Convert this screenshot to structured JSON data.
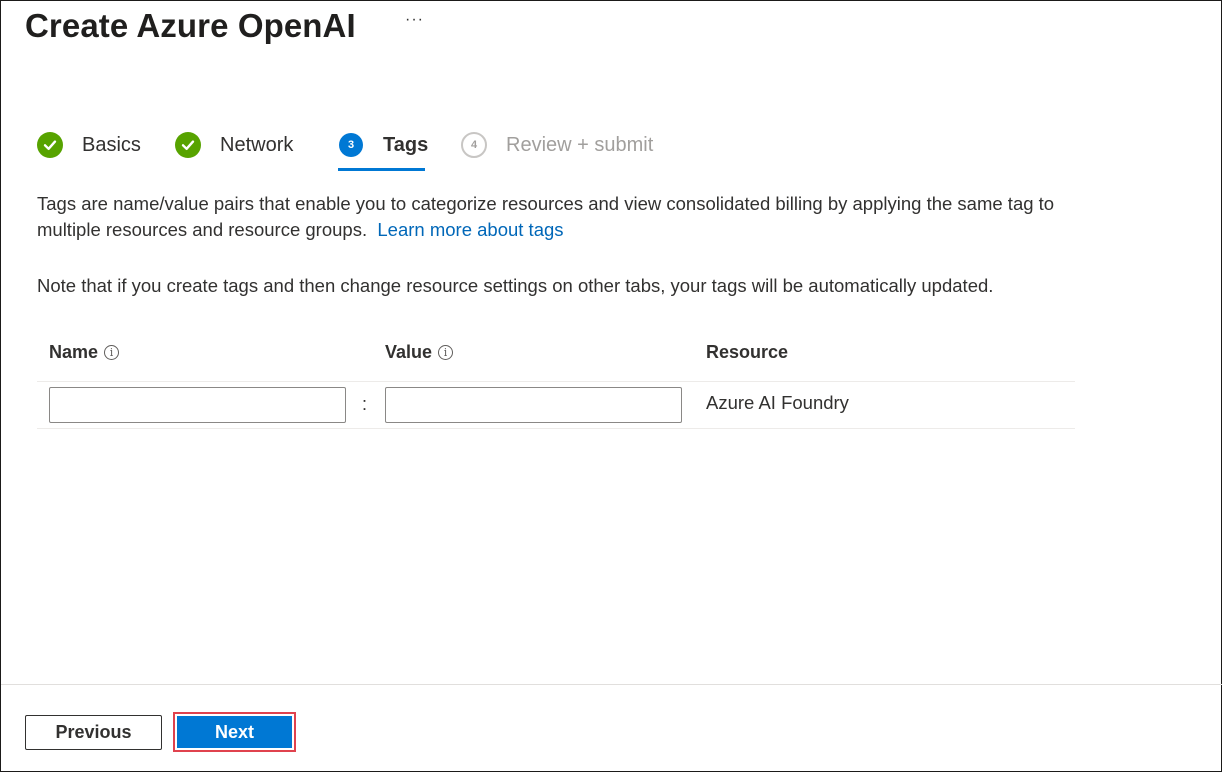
{
  "header": {
    "title": "Create Azure OpenAI",
    "more_label": "···"
  },
  "stepper": {
    "steps": [
      {
        "label": "Basics",
        "state": "done",
        "number": ""
      },
      {
        "label": "Network",
        "state": "done",
        "number": ""
      },
      {
        "label": "Tags",
        "state": "current",
        "number": "3"
      },
      {
        "label": "Review + submit",
        "state": "future",
        "number": "4"
      }
    ]
  },
  "content": {
    "description": "Tags are name/value pairs that enable you to categorize resources and view consolidated billing by applying the same tag to multiple resources and resource groups.",
    "learn_more": "Learn more about tags",
    "note": "Note that if you create tags and then change resource settings on other tabs, your tags will be automatically updated."
  },
  "table": {
    "columns": {
      "name": "Name",
      "value": "Value",
      "resource": "Resource"
    },
    "rows": [
      {
        "name": "",
        "value": "",
        "separator": ":",
        "resource": "Azure AI Foundry"
      }
    ]
  },
  "footer": {
    "previous_label": "Previous",
    "next_label": "Next"
  },
  "colors": {
    "accent": "#0078d4",
    "success": "#57a300",
    "highlight_border": "#e0424e"
  },
  "icons": {
    "done": "checkmark-icon",
    "info": "info-icon"
  }
}
